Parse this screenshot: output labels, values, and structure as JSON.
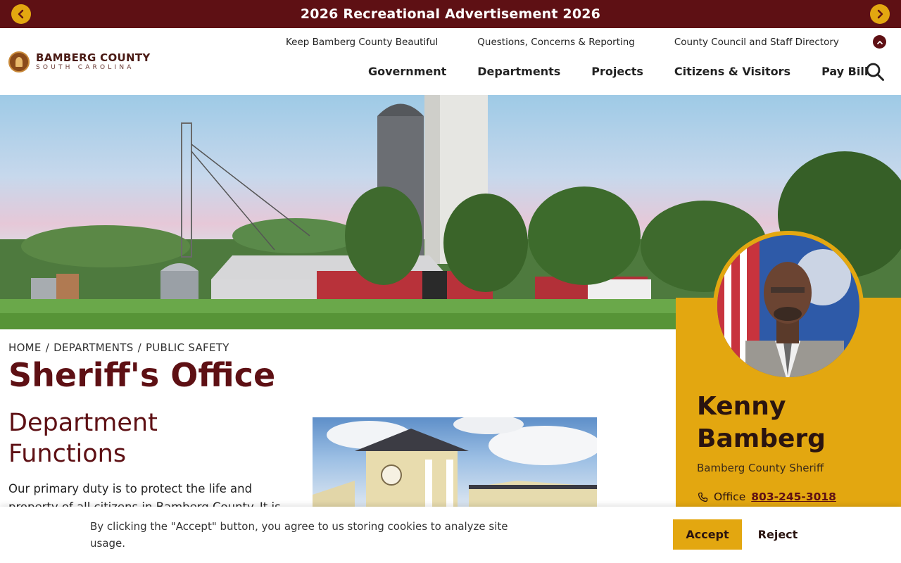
{
  "alert": {
    "title": "2026 Recreational Advertisement 2026",
    "prev_icon": "chevron-left-icon",
    "next_icon": "chevron-right-icon"
  },
  "header": {
    "logo": {
      "name": "BAMBERG COUNTY",
      "subtitle": "SOUTH CAROLINA"
    },
    "utility_nav": [
      {
        "label": "Keep Bamberg County Beautiful"
      },
      {
        "label": "Questions, Concerns & Reporting"
      },
      {
        "label": "County Council and Staff Directory"
      }
    ],
    "main_nav": [
      {
        "label": "Government"
      },
      {
        "label": "Departments"
      },
      {
        "label": "Projects"
      },
      {
        "label": "Citizens & Visitors"
      },
      {
        "label": "Pay Bill"
      }
    ],
    "search_icon": "search-icon",
    "collapse_icon": "chevron-up-icon"
  },
  "breadcrumb": {
    "items": [
      "HOME",
      "DEPARTMENTS",
      "PUBLIC SAFETY"
    ],
    "separator": "/"
  },
  "page": {
    "title": "Sheriff's Office",
    "section_heading": "Department Functions",
    "body_text": "Our primary duty is to protect the life and property of all citizens in Bamberg County. It is"
  },
  "profile": {
    "name": "Kenny Bamberg",
    "role": "Bamberg County Sheriff",
    "phone_label": "Office",
    "phone": "803-245-3018",
    "phone_icon": "phone-icon"
  },
  "cookie": {
    "text": "By clicking the \"Accept\" button, you agree to us storing cookies to analyze site usage.",
    "accept_label": "Accept",
    "reject_label": "Reject"
  },
  "colors": {
    "maroon": "#5e1014",
    "gold": "#e3a710"
  }
}
